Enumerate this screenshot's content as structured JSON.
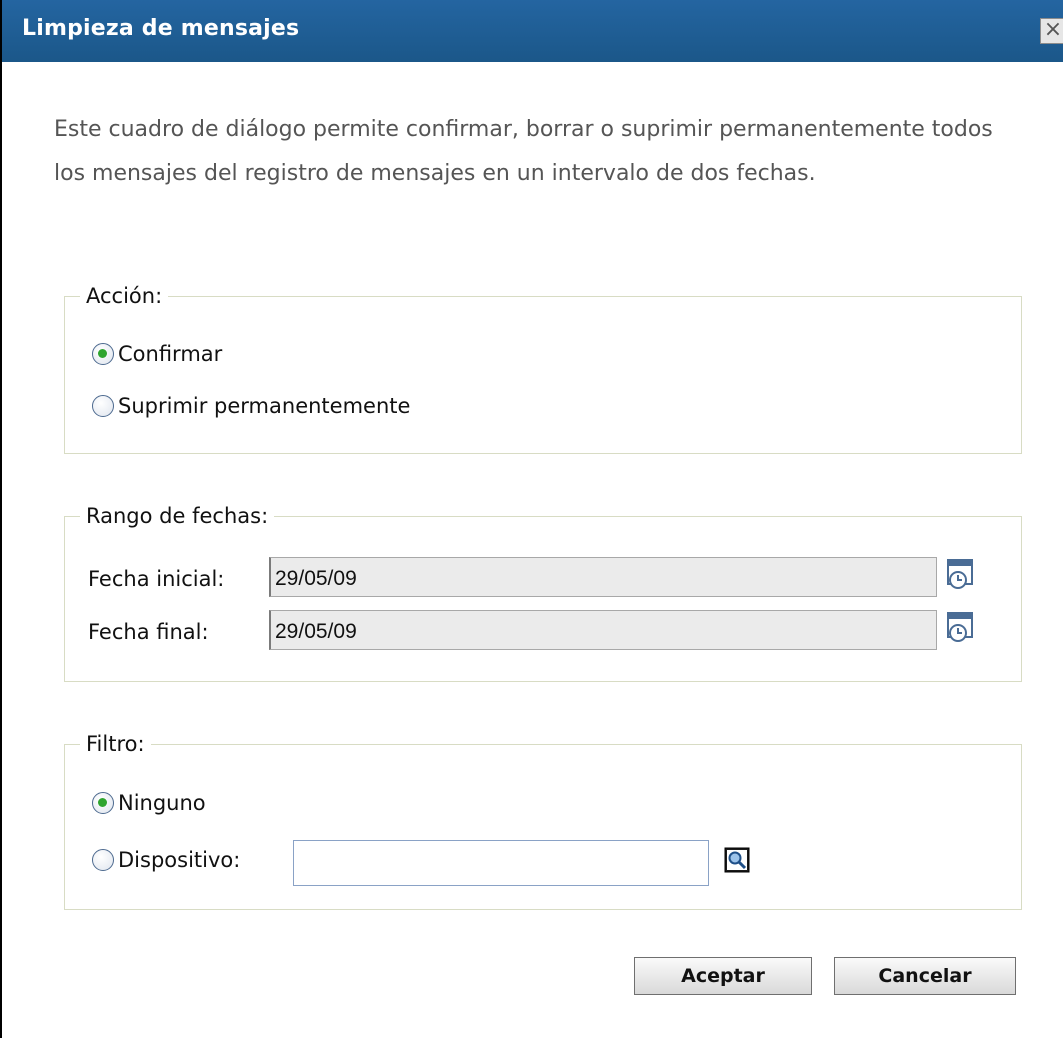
{
  "dialog": {
    "title": "Limpieza de mensajes",
    "close_label": "×"
  },
  "description": "Este cuadro de diálogo permite confirmar, borrar o suprimir permanentemente todos los mensajes del registro de mensajes en un intervalo de dos fechas.",
  "action_group": {
    "legend": "Acción:",
    "options": [
      {
        "label": "Confirmar",
        "selected": true
      },
      {
        "label": "Suprimir permanentemente",
        "selected": false
      }
    ]
  },
  "date_range_group": {
    "legend": "Rango de fechas:",
    "start_label": "Fecha inicial:",
    "start_value": "29/05/09",
    "end_label": "Fecha final:",
    "end_value": "29/05/09"
  },
  "filter_group": {
    "legend": "Filtro:",
    "options": [
      {
        "label": "Ninguno",
        "selected": true
      },
      {
        "label": "Dispositivo:",
        "selected": false
      }
    ],
    "device_value": ""
  },
  "buttons": {
    "accept": "Aceptar",
    "cancel": "Cancelar"
  },
  "colors": {
    "titlebar": "#1d5b92",
    "group_border": "#d8dcc4",
    "radio_checked": "#2fa52f"
  },
  "icons": [
    "close-icon",
    "calendar-icon",
    "search-icon"
  ]
}
